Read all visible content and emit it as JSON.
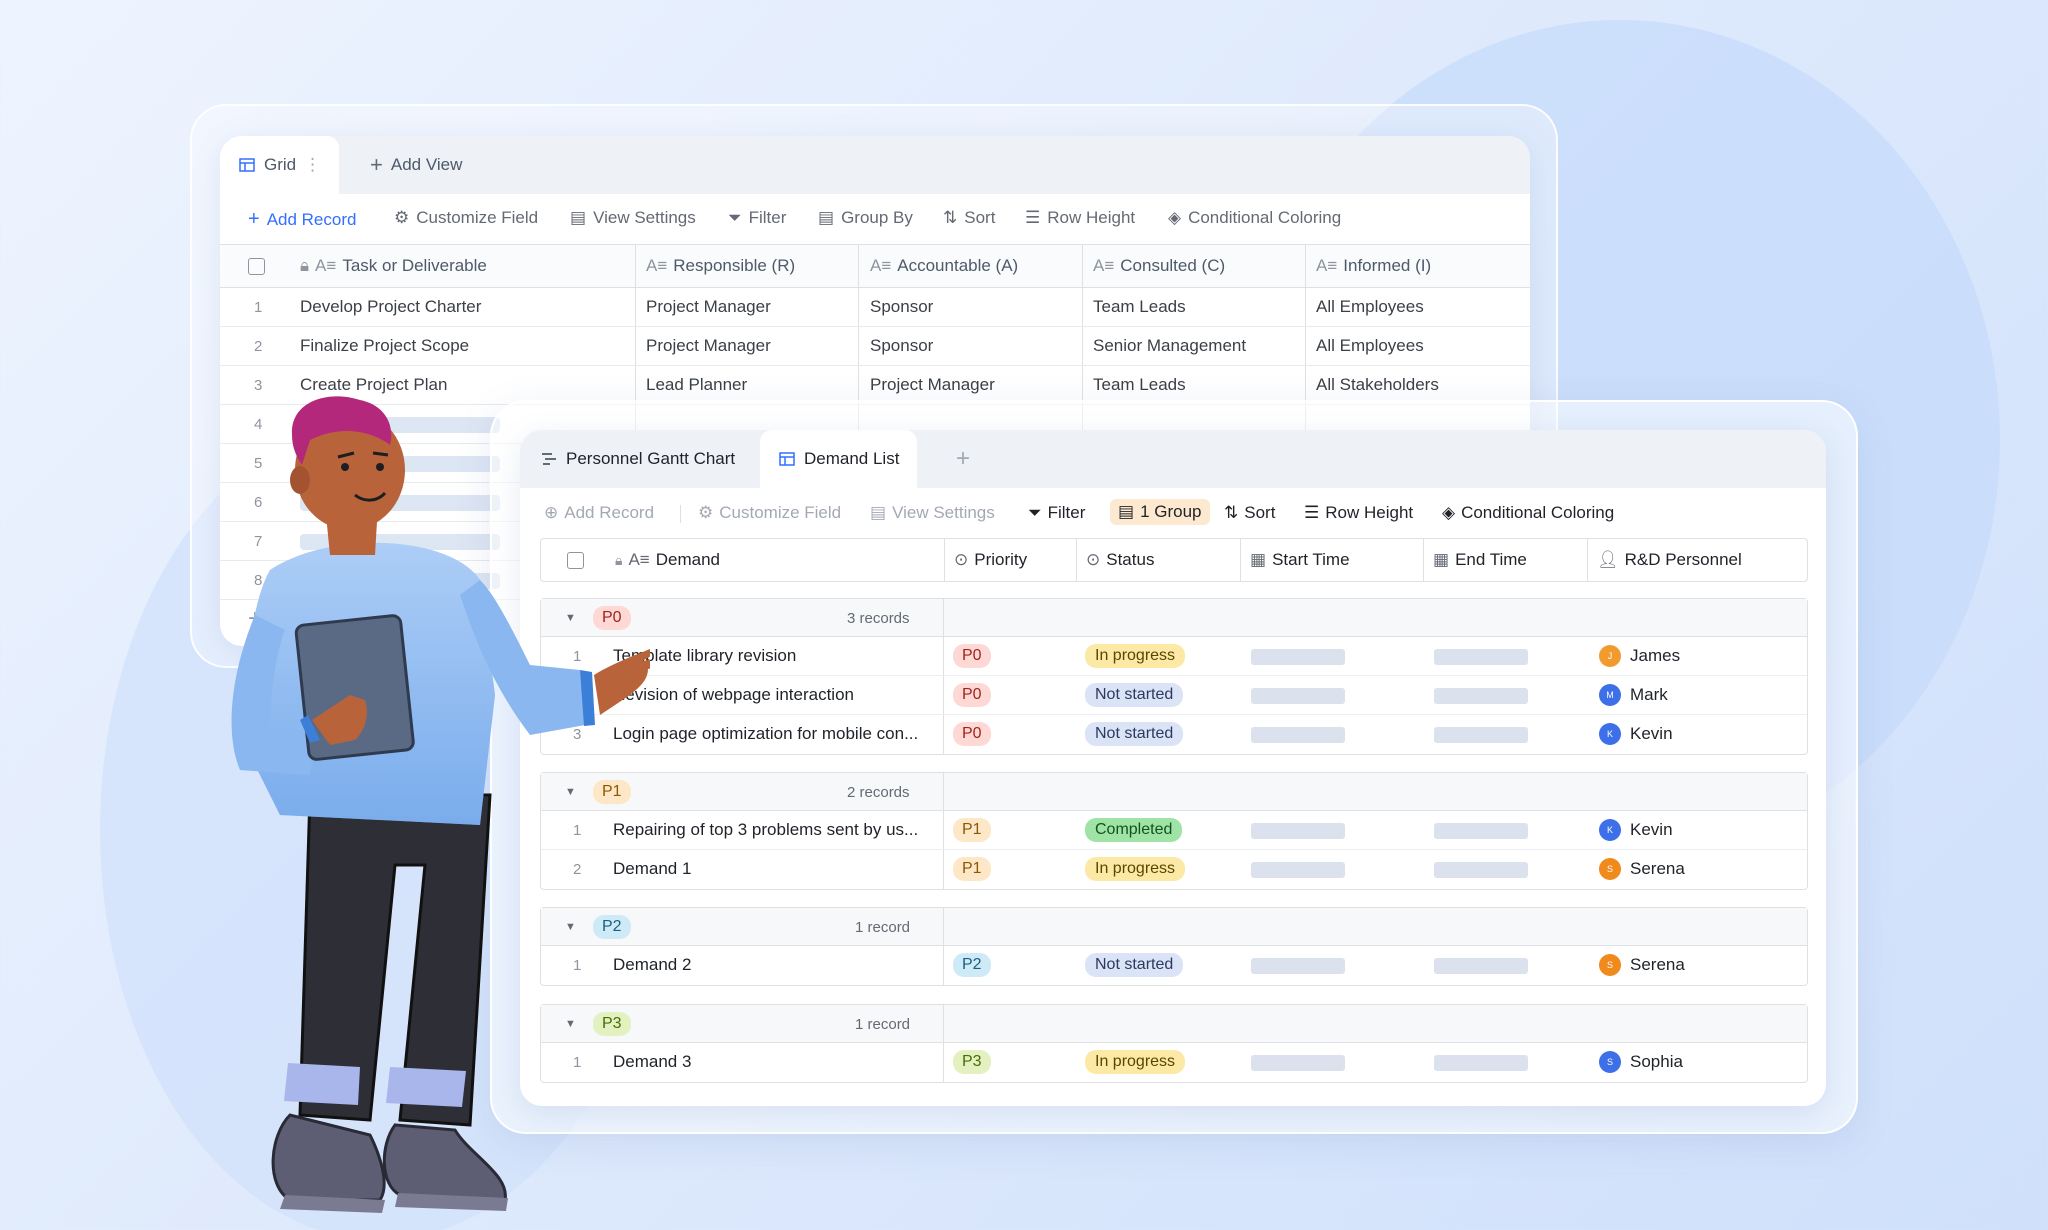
{
  "colors": {
    "accent": "#3370ff",
    "priority_p0": "#fdd8d5",
    "priority_p1": "#fde7c7",
    "priority_p2": "#cfeaf7",
    "priority_p3": "#e3f1c0",
    "status_in_progress": "#fce9a6",
    "status_not_started": "#dbe3f7",
    "status_completed": "#9fe3a6"
  },
  "back": {
    "tabs": {
      "grid": "Grid",
      "add_view": "Add View"
    },
    "toolbar": {
      "add_record": "Add Record",
      "customize_field": "Customize Field",
      "view_settings": "View Settings",
      "filter": "Filter",
      "group_by": "Group By",
      "sort": "Sort",
      "row_height": "Row Height",
      "conditional_coloring": "Conditional Coloring"
    },
    "columns": [
      "Task or Deliverable",
      "Responsible (R)",
      "Accountable (A)",
      "Consulted (C)",
      "Informed (I)"
    ],
    "rows": [
      {
        "num": "1",
        "task": "Develop Project Charter",
        "r": "Project Manager",
        "a": "Sponsor",
        "c": "Team Leads",
        "i": "All Employees"
      },
      {
        "num": "2",
        "task": "Finalize Project Scope",
        "r": "Project Manager",
        "a": "Sponsor",
        "c": "Senior Management",
        "i": "All Employees"
      },
      {
        "num": "3",
        "task": "Create Project Plan",
        "r": "Lead Planner",
        "a": "Project Manager",
        "c": "Team Leads",
        "i": "All Stakeholders"
      }
    ],
    "placeholder_rows": [
      "4",
      "5",
      "6",
      "7",
      "8"
    ],
    "add_row_icon": "plus-icon"
  },
  "front": {
    "tabs": {
      "gantt": "Personnel Gantt Chart",
      "demand_list": "Demand List",
      "add": "+"
    },
    "toolbar": {
      "add_record": "Add Record",
      "customize_field": "Customize Field",
      "view_settings": "View Settings",
      "filter": "Filter",
      "group": "1 Group",
      "sort": "Sort",
      "row_height": "Row Height",
      "conditional_coloring": "Conditional Coloring"
    },
    "columns": {
      "demand": "Demand",
      "priority": "Priority",
      "status": "Status",
      "start_time": "Start Time",
      "end_time": "End Time",
      "personnel": "R&D Personnel"
    },
    "groups": [
      {
        "label": "P0",
        "count": "3 records",
        "rows": [
          {
            "num": "1",
            "demand": "Template library revision",
            "priority": "P0",
            "status": "In progress",
            "person": "James",
            "initial": "J",
            "color": "#f29a2e"
          },
          {
            "num": "2",
            "demand": "Revision of webpage interaction",
            "priority": "P0",
            "status": "Not started",
            "person": "Mark",
            "initial": "M",
            "color": "#3d6fe8"
          },
          {
            "num": "3",
            "demand": "Login page optimization for mobile con...",
            "priority": "P0",
            "status": "Not started",
            "person": "Kevin",
            "initial": "K",
            "color": "#3d6fe8"
          }
        ]
      },
      {
        "label": "P1",
        "count": "2 records",
        "rows": [
          {
            "num": "1",
            "demand": "Repairing of top 3 problems sent by us...",
            "priority": "P1",
            "status": "Completed",
            "person": "Kevin",
            "initial": "K",
            "color": "#3d6fe8"
          },
          {
            "num": "2",
            "demand": "Demand 1",
            "priority": "P1",
            "status": "In progress",
            "person": "Serena",
            "initial": "S",
            "color": "#f08a1c"
          }
        ]
      },
      {
        "label": "P2",
        "count": "1 record",
        "rows": [
          {
            "num": "1",
            "demand": "Demand 2",
            "priority": "P2",
            "status": "Not started",
            "person": "Serena",
            "initial": "S",
            "color": "#f08a1c"
          }
        ]
      },
      {
        "label": "P3",
        "count": "1 record",
        "rows": [
          {
            "num": "1",
            "demand": "Demand 3",
            "priority": "P3",
            "status": "In progress",
            "person": "Sophia",
            "initial": "S",
            "color": "#3d6fe8"
          }
        ]
      }
    ]
  }
}
